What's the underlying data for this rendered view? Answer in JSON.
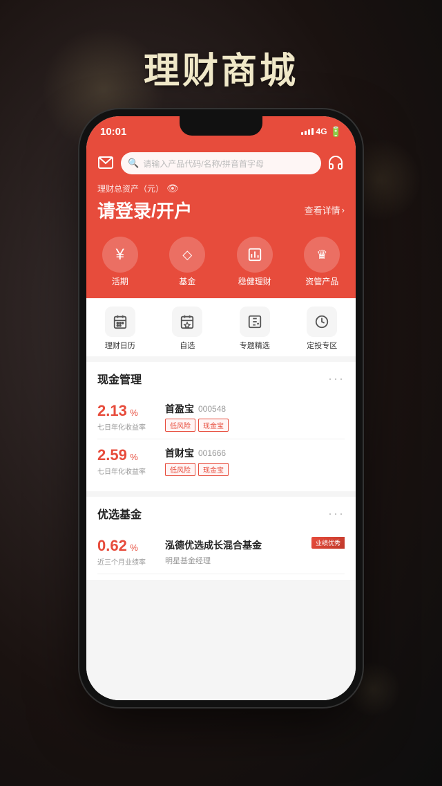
{
  "app": {
    "title": "理财商城"
  },
  "status_bar": {
    "time": "10:01",
    "signal": "4G"
  },
  "header": {
    "search_placeholder": "请输入产品代码/名称/拼音首字母",
    "asset_label": "理财总资产（元）",
    "asset_amount": "请登录/开户",
    "view_detail": "查看详情"
  },
  "quick_nav": [
    {
      "icon": "¥",
      "label": "活期"
    },
    {
      "icon": "◇",
      "label": "基金"
    },
    {
      "icon": "📊",
      "label": "稳健理财"
    },
    {
      "icon": "♛",
      "label": "资管产品"
    }
  ],
  "second_nav": [
    {
      "icon": "📅",
      "label": "理财日历"
    },
    {
      "icon": "♡",
      "label": "自选"
    },
    {
      "icon": "🔖",
      "label": "专题精选"
    },
    {
      "icon": "⏱",
      "label": "定投专区"
    }
  ],
  "cash_section": {
    "title": "现金管理",
    "items": [
      {
        "rate": "2.13",
        "rate_label": "七日年化收益率",
        "name": "首盈宝",
        "code": "000548",
        "tags": [
          "低风险",
          "现金宝"
        ]
      },
      {
        "rate": "2.59",
        "rate_label": "七日年化收益率",
        "name": "首财宝",
        "code": "001666",
        "tags": [
          "低风险",
          "现金宝"
        ]
      }
    ]
  },
  "preferred_section": {
    "title": "优选基金",
    "items": [
      {
        "rate": "0.62",
        "rate_label": "近三个月业绩率",
        "name": "泓德优选成长混合基金",
        "sub": "明星基金经理",
        "badge": "业绩优秀"
      }
    ]
  }
}
